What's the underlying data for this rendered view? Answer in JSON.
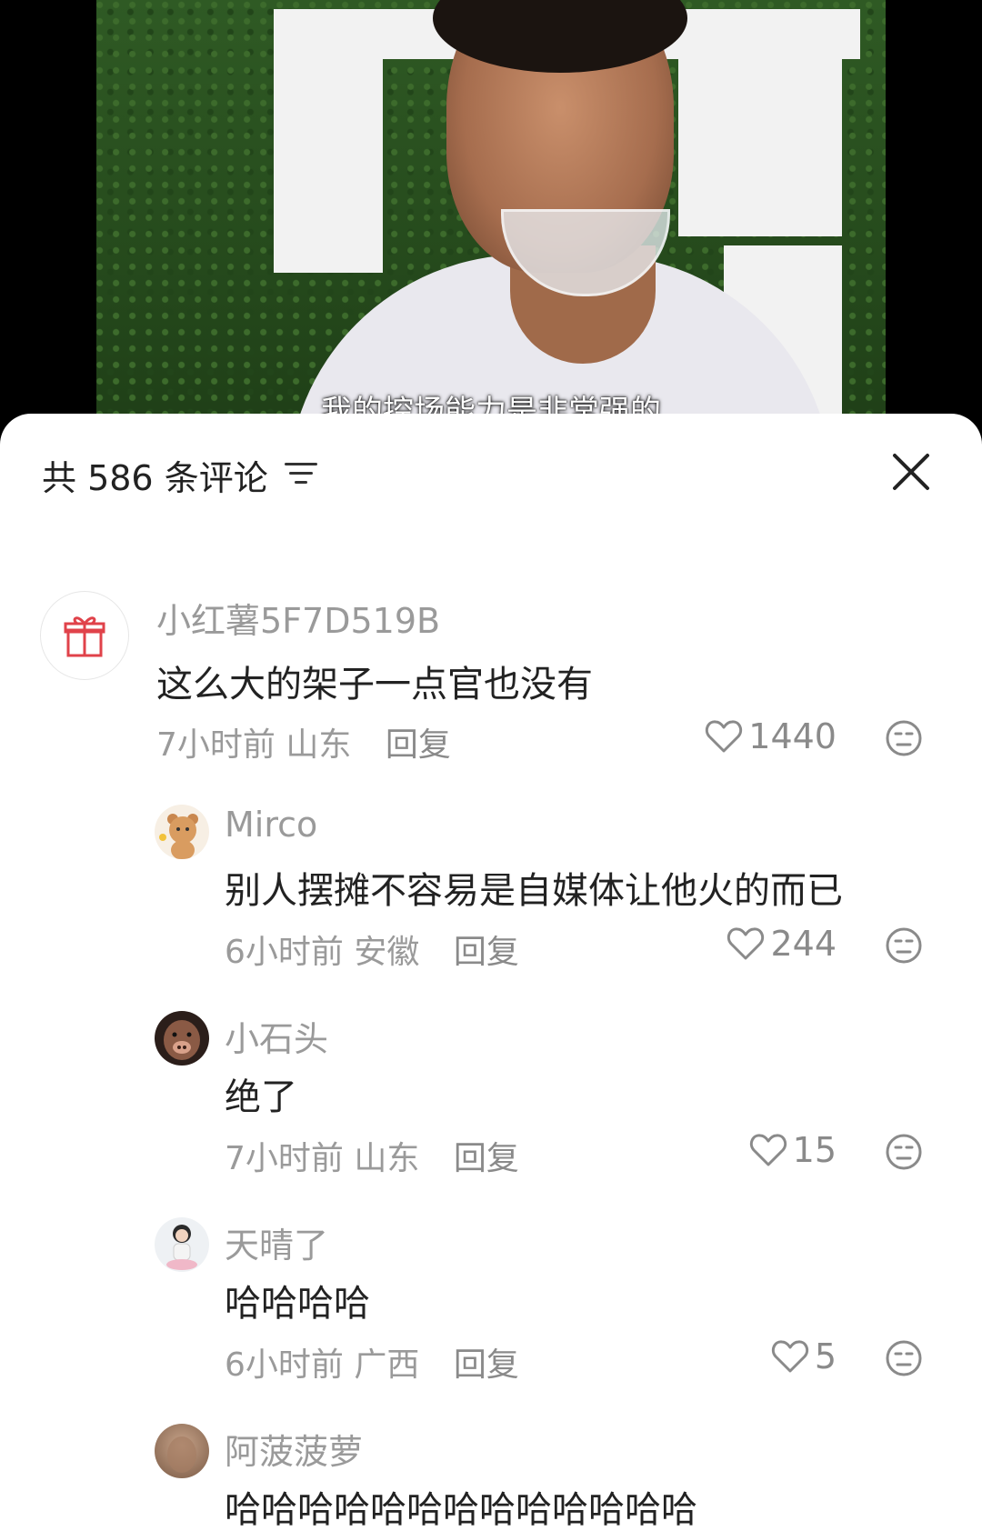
{
  "video": {
    "subtitle": "我的控场能力是非常强的"
  },
  "header": {
    "count_label": "共 586 条评论",
    "sort_icon": "filter-lines-icon",
    "close_icon": "close-icon"
  },
  "comments": [
    {
      "user": "小红薯5F7D519B",
      "text": "这么大的架子一点官也没有",
      "time": "7小时前",
      "location": "山东",
      "reply": "回复",
      "likes": "1440",
      "avatar": "gift-icon"
    },
    {
      "user": "Mirco",
      "text": "别人摆摊不容易是自媒体让他火的而已",
      "time": "6小时前",
      "location": "安徽",
      "reply": "回复",
      "likes": "244",
      "avatar": "bear-avatar"
    },
    {
      "user": "小石头",
      "text": "绝了",
      "time": "7小时前",
      "location": "山东",
      "reply": "回复",
      "likes": "15",
      "avatar": "pig-avatar"
    },
    {
      "user": "天晴了",
      "text": "哈哈哈哈",
      "time": "6小时前",
      "location": "广西",
      "reply": "回复",
      "likes": "5",
      "avatar": "girl-avatar"
    },
    {
      "user": "阿菠菠萝",
      "text": "哈哈哈哈哈哈哈哈哈哈哈哈哈",
      "avatar": "photo-avatar"
    }
  ],
  "colors": {
    "muted": "#9a9a9a",
    "text": "#222222",
    "accent_red": "#e0424a"
  }
}
